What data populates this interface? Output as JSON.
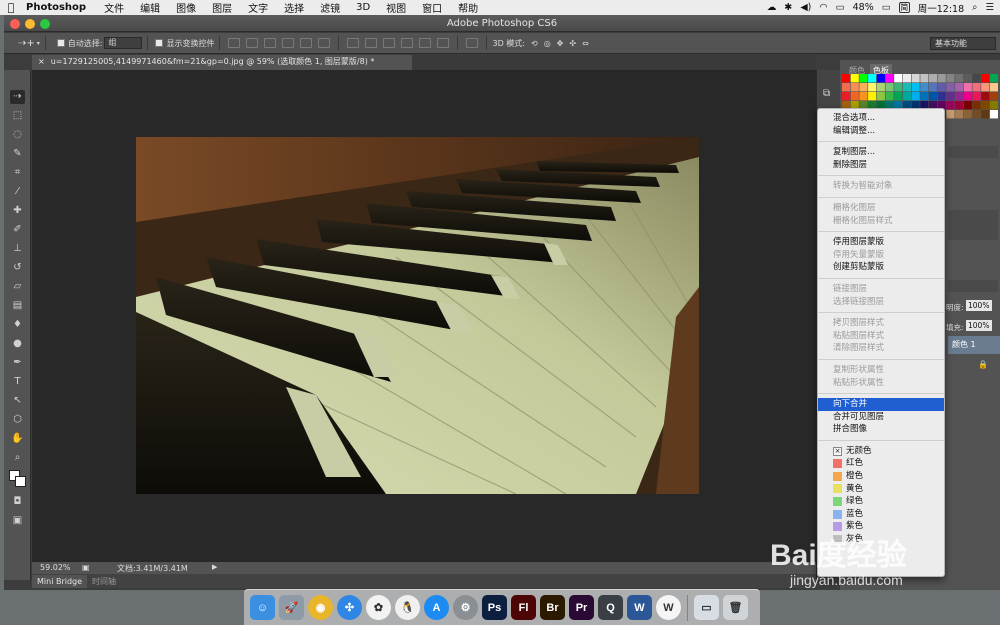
{
  "menubar": {
    "app": "Photoshop",
    "items": [
      "文件",
      "编辑",
      "图像",
      "图层",
      "文字",
      "选择",
      "滤镜",
      "3D",
      "视图",
      "窗口",
      "帮助"
    ],
    "battery": "48%",
    "ime": "简",
    "clock": "周一12:18"
  },
  "window": {
    "title": "Adobe Photoshop CS6"
  },
  "options_bar": {
    "auto_select_label": "自动选择:",
    "auto_select_value": "组",
    "transform_label": "显示变换控件",
    "mode_3d_label": "3D 模式:",
    "workspace": "基本功能"
  },
  "doc_tab": {
    "close": "×",
    "title": "u=1729125005,4149971460&fm=21&gp=0.jpg @ 59% (选取颜色 1, 图层蒙版/8) *"
  },
  "status": {
    "zoom": "59.02%",
    "doc": "文档:3.41M/3.41M"
  },
  "bottom_tabs": {
    "mini_bridge": "Mini Bridge",
    "timeline": "时间轴"
  },
  "panels": {
    "color_tab": "颜色",
    "swatches_tab": "色板",
    "opacity_value": "100%",
    "fill_value": "100%",
    "opacity_label_tail": "明度:",
    "fill_label_tail": "填充:",
    "layer_name_tail": "颜色 1"
  },
  "context_menu": {
    "items": [
      {
        "label": "混合选项...",
        "state": "enabled"
      },
      {
        "label": "编辑调整...",
        "state": "enabled"
      },
      {
        "sep": true
      },
      {
        "label": "复制图层...",
        "state": "enabled"
      },
      {
        "label": "删除图层",
        "state": "enabled"
      },
      {
        "sep": true
      },
      {
        "label": "转换为智能对象",
        "state": "disabled"
      },
      {
        "sep": true
      },
      {
        "label": "栅格化图层",
        "state": "disabled"
      },
      {
        "label": "栅格化图层样式",
        "state": "disabled"
      },
      {
        "sep": true
      },
      {
        "label": "停用图层蒙版",
        "state": "enabled"
      },
      {
        "label": "停用矢量蒙版",
        "state": "disabled"
      },
      {
        "label": "创建剪贴蒙版",
        "state": "enabled"
      },
      {
        "sep": true
      },
      {
        "label": "链接图层",
        "state": "disabled"
      },
      {
        "label": "选择链接图层",
        "state": "disabled"
      },
      {
        "sep": true
      },
      {
        "label": "拷贝图层样式",
        "state": "disabled"
      },
      {
        "label": "粘贴图层样式",
        "state": "disabled"
      },
      {
        "label": "清除图层样式",
        "state": "disabled"
      },
      {
        "sep": true
      },
      {
        "label": "复制形状属性",
        "state": "disabled"
      },
      {
        "label": "粘贴形状属性",
        "state": "disabled"
      },
      {
        "sep": true
      },
      {
        "label": "向下合并",
        "state": "highlighted"
      },
      {
        "label": "合并可见图层",
        "state": "enabled"
      },
      {
        "label": "拼合图像",
        "state": "enabled"
      },
      {
        "sep": true
      },
      {
        "label": "无颜色",
        "state": "enabled",
        "color": "none"
      },
      {
        "label": "红色",
        "state": "enabled",
        "color": "#f07167"
      },
      {
        "label": "橙色",
        "state": "enabled",
        "color": "#f5a54a"
      },
      {
        "label": "黄色",
        "state": "enabled",
        "color": "#e8e05a"
      },
      {
        "label": "绿色",
        "state": "enabled",
        "color": "#7ed67a"
      },
      {
        "label": "蓝色",
        "state": "enabled",
        "color": "#8ab4ef"
      },
      {
        "label": "紫色",
        "state": "enabled",
        "color": "#b79be6"
      },
      {
        "label": "灰色",
        "state": "enabled",
        "color": "#bdbdbd"
      }
    ]
  },
  "watermark": {
    "logo": "Bai度经验",
    "url": "jingyan.baidu.com"
  },
  "dock": {
    "apps": [
      {
        "name": "finder-icon",
        "color": "#3b8fe0",
        "glyph": "☺"
      },
      {
        "name": "launchpad-icon",
        "color": "#8e9aa6",
        "glyph": "🚀"
      },
      {
        "name": "chrome-icon",
        "color": "#e9b52a",
        "glyph": "◉"
      },
      {
        "name": "safari-icon",
        "color": "#2f86e4",
        "glyph": "✣"
      },
      {
        "name": "photos-icon",
        "color": "#f2f2f2",
        "glyph": "✿"
      },
      {
        "name": "qq-icon",
        "color": "#f0f0f0",
        "glyph": "🐧"
      },
      {
        "name": "appstore-icon",
        "color": "#1e8bf3",
        "glyph": "A"
      },
      {
        "name": "system-prefs-icon",
        "color": "#8a8f94",
        "glyph": "⚙"
      },
      {
        "name": "ps-icon",
        "color": "#0c1f3f",
        "glyph": "Ps"
      },
      {
        "name": "flash-icon",
        "color": "#4d0606",
        "glyph": "Fl"
      },
      {
        "name": "bridge-icon",
        "color": "#2c1a00",
        "glyph": "Br"
      },
      {
        "name": "premiere-icon",
        "color": "#2a0a35",
        "glyph": "Pr"
      },
      {
        "name": "quicktime-icon",
        "color": "#3a3f46",
        "glyph": "Q"
      },
      {
        "name": "word-icon",
        "color": "#2b5797",
        "glyph": "W"
      },
      {
        "name": "wunderlist-icon",
        "color": "#f5f5f5",
        "glyph": "W"
      },
      {
        "name": "preview-icon",
        "color": "#d8dde3",
        "glyph": "▭"
      },
      {
        "name": "trash-icon",
        "color": "#cfd4d8",
        "glyph": "🗑"
      }
    ]
  }
}
